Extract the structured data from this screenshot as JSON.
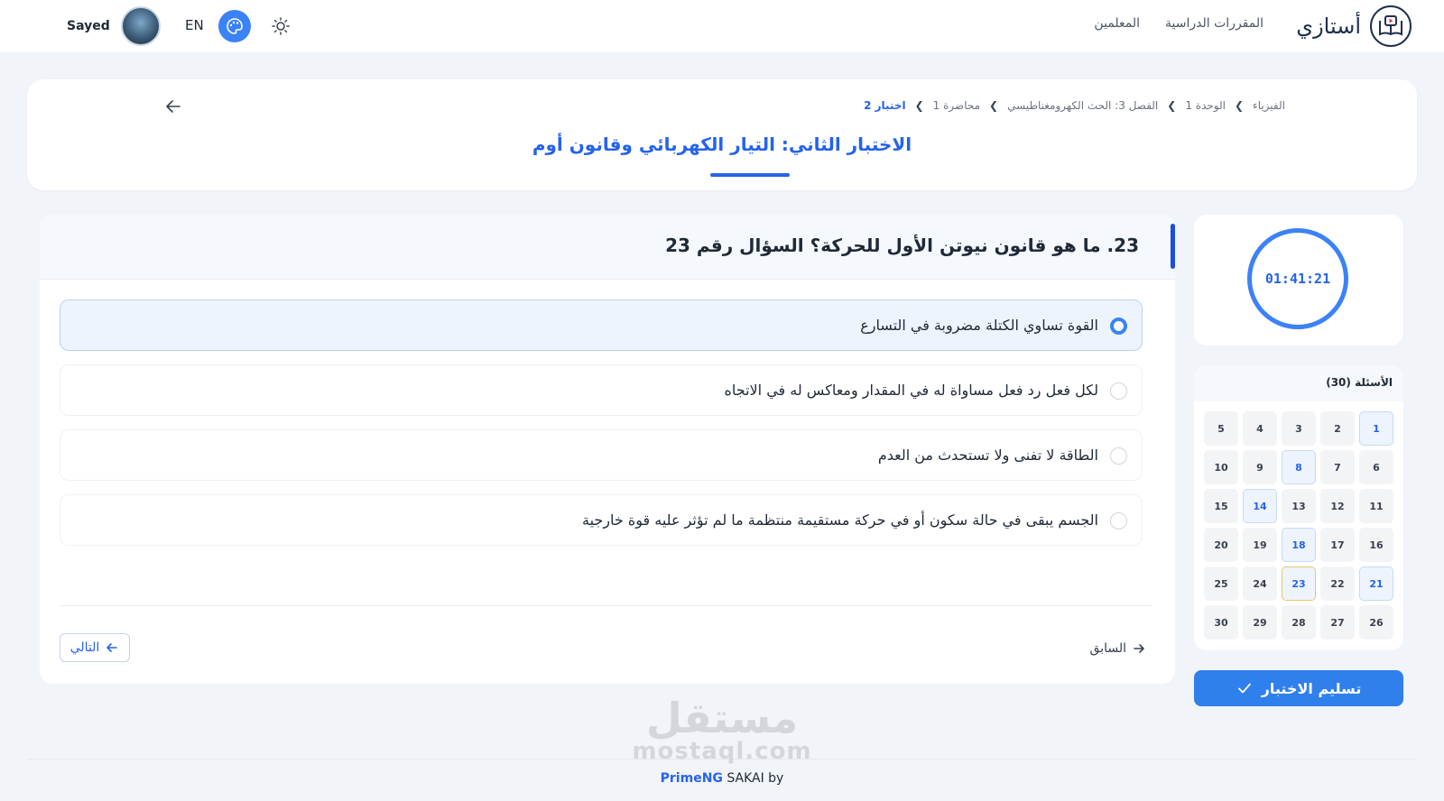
{
  "brand": {
    "name": "أستازي"
  },
  "topnav": {
    "courses": "المقررات الدراسية",
    "teachers": "المعلمين"
  },
  "user": {
    "name": "Sayed",
    "lang": "EN"
  },
  "breadcrumb": {
    "items": [
      "الفيزياء",
      "الوحدة 1",
      "الفصل 3: الحث الكهرومغناطيسي",
      "محاضرة 1",
      "اختبار 2"
    ]
  },
  "quiz": {
    "title": "الاختبار الثاني: التيار الكهربائي وقانون أوم"
  },
  "question": {
    "text": "23. ما هو قانون نيوتن الأول للحركة؟ السؤال رقم 23",
    "options": [
      {
        "label": "القوة تساوي الكتلة مضروبة في التسارع",
        "selected": true
      },
      {
        "label": "لكل فعل رد فعل مساواة له في المقدار ومعاكس له في الاتجاه",
        "selected": false
      },
      {
        "label": "الطاقة لا تفنى ولا تستحدث من العدم",
        "selected": false
      },
      {
        "label": "الجسم يبقى في حالة سكون أو في حركة مستقيمة منتظمة ما لم تؤثر عليه قوة خارجية",
        "selected": false
      }
    ],
    "next_label": "التالي",
    "prev_label": "السابق"
  },
  "timer": {
    "value": "01:41:21"
  },
  "navigator": {
    "title": "الأسئلة (30)",
    "answered": [
      1,
      8,
      14,
      18,
      21
    ],
    "current": 23,
    "count": 30
  },
  "submit": {
    "label": "تسليم الاختبار"
  },
  "watermark": {
    "arabic": "مستقل",
    "latin": "mostaql.com"
  },
  "footer": {
    "prefix": "SAKAI by",
    "link": "PrimeNG"
  },
  "colors": {
    "primary": "#2563eb",
    "accent": "#3b82f6",
    "current_border": "#e8c66a"
  }
}
